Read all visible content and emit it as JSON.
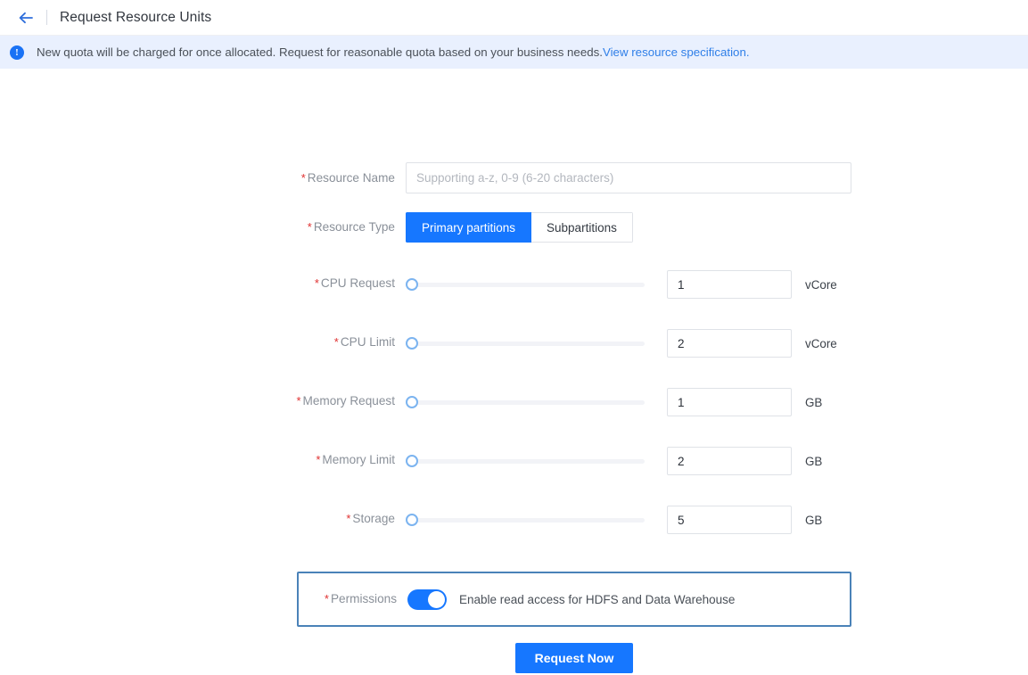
{
  "header": {
    "back_icon": "arrow-left-icon",
    "title": "Request Resource Units"
  },
  "banner": {
    "icon": "info-circle-icon",
    "text": "New quota will be charged for once allocated. Request for reasonable quota based on your business needs.",
    "link_text": "View resource specification."
  },
  "form": {
    "resource_name": {
      "label": "Resource Name",
      "required_marker": "*",
      "placeholder": "Supporting a-z, 0-9 (6-20 characters)",
      "value": ""
    },
    "resource_type": {
      "label": "Resource Type",
      "required_marker": "*",
      "options": [
        "Primary partitions",
        "Subpartitions"
      ],
      "selected": "Primary partitions"
    },
    "sliders": [
      {
        "label": "CPU Request",
        "required_marker": "*",
        "value": "1",
        "unit": "vCore",
        "percent": 0
      },
      {
        "label": "CPU Limit",
        "required_marker": "*",
        "value": "2",
        "unit": "vCore",
        "percent": 0
      },
      {
        "label": "Memory Request",
        "required_marker": "*",
        "value": "1",
        "unit": "GB",
        "percent": 0
      },
      {
        "label": "Memory Limit",
        "required_marker": "*",
        "value": "2",
        "unit": "GB",
        "percent": 0
      },
      {
        "label": "Storage",
        "required_marker": "*",
        "value": "5",
        "unit": "GB",
        "percent": 0
      }
    ],
    "permissions": {
      "label": "Permissions",
      "required_marker": "*",
      "toggle_on": true,
      "description": "Enable read access for HDFS and Data Warehouse"
    },
    "submit_label": "Request Now"
  },
  "colors": {
    "accent": "#1677ff",
    "link": "#2f7fe8",
    "required": "#e03131",
    "banner_bg": "#e9f0fe",
    "highlight_border": "#4a82b8",
    "slider_handle_border": "#7cb4f0"
  }
}
